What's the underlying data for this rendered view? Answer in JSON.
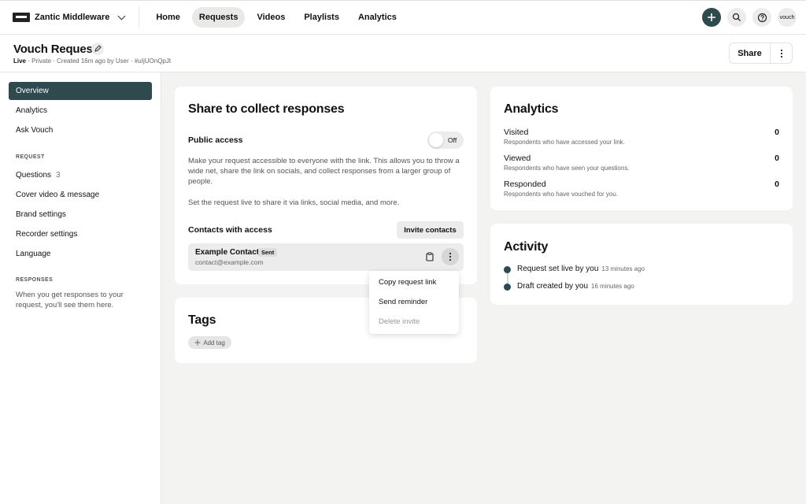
{
  "topnav": {
    "org_name": "Zantic Middleware",
    "links": [
      "Home",
      "Requests",
      "Videos",
      "Playlists",
      "Analytics"
    ],
    "active_link": "Requests",
    "avatar_text": "vouch",
    "icons": [
      "plus-icon",
      "search-icon",
      "help-icon"
    ]
  },
  "header": {
    "title": "Vouch Request",
    "status": "Live",
    "meta_rest": " · Private · Created 16m ago by User · #uIjUOnQpJt",
    "share_label": "Share"
  },
  "sidebar": {
    "items_main": [
      "Overview",
      "Analytics",
      "Ask Vouch"
    ],
    "request_heading": "REQUEST",
    "questions_label": "Questions",
    "questions_count": "3",
    "request_items": [
      "Cover video & message",
      "Brand settings",
      "Recorder settings",
      "Language"
    ],
    "responses_heading": "RESPONSES",
    "responses_note": "When you get responses to your request, you'll see them here."
  },
  "share_card": {
    "title": "Share to collect responses",
    "public_access_label": "Public access",
    "toggle_label": "Off",
    "description": "Make your request accessible to everyone with the link. This allows you to throw a wide net, share the link on socials, and collect responses from a larger group of people.",
    "live_note": "Set the request live to share it via links, social media, and more.",
    "contacts_label": "Contacts with access",
    "invite_label": "Invite contacts",
    "contact": {
      "name": "Example Contact",
      "badge": "Sent",
      "email": "contact@example.com"
    }
  },
  "context_menu": {
    "items": [
      "Copy request link",
      "Send reminder",
      "Delete invite"
    ]
  },
  "tags_card": {
    "title": "Tags",
    "add_label": "Add tag"
  },
  "analytics_card": {
    "title": "Analytics",
    "rows": [
      {
        "label": "Visited",
        "sub": "Respondents who have accessed your link.",
        "value": "0"
      },
      {
        "label": "Viewed",
        "sub": "Respondents who have seen your questions.",
        "value": "0"
      },
      {
        "label": "Responded",
        "sub": "Respondents who have vouched for you.",
        "value": "0"
      }
    ]
  },
  "activity_card": {
    "title": "Activity",
    "events": [
      {
        "text": "Request set live by you",
        "time": "13 minutes ago"
      },
      {
        "text": "Draft created by you",
        "time": "16 minutes ago"
      }
    ]
  },
  "colors": {
    "accent": "#2e4a4f"
  }
}
